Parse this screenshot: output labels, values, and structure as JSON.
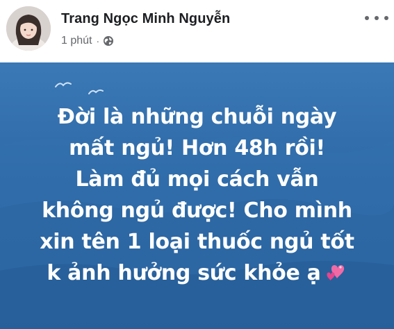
{
  "post": {
    "author_name": "Trang Ngọc Minh Nguyễn",
    "time": "1 phút",
    "separator": "·",
    "privacy_icon": "globe-icon",
    "menu_icon": "more-options-icon",
    "status": {
      "background_color": "#2f6aa8",
      "text_color": "#ffffff",
      "lines": [
        "Đời là những chuỗi ngày",
        "mất ngủ! Hơn 48h rồi!",
        "Làm đủ mọi cách vẫn",
        "không ngủ được! Cho mình",
        "xin tên 1 loại thuốc ngủ tốt",
        "k ảnh hưởng sức khỏe ạ"
      ],
      "trailing_emoji": "two-hearts-emoji"
    }
  }
}
